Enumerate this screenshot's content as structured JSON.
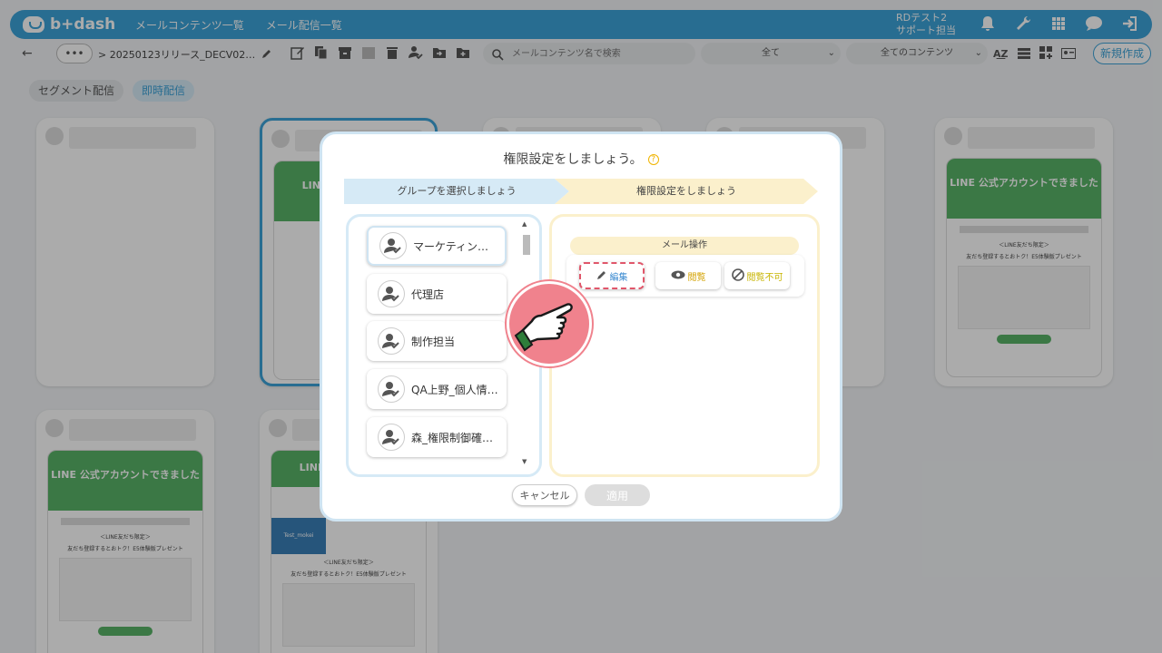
{
  "app": {
    "logo_text": "b+dash",
    "nav": [
      "メールコンテンツ一覧",
      "メール配信一覧"
    ],
    "user_line1": "RDテスト2",
    "user_line2": "サポート担当"
  },
  "toolbar": {
    "dots": "•••",
    "breadcrumb": "> 20250123リリース_DECV02…",
    "search_placeholder": "メールコンテンツ名で検索",
    "filter1": "全て",
    "filter2": "全てのコンテンツ",
    "new_button": "新規作成"
  },
  "segments": {
    "tab1": "セグメント配信",
    "tab2": "即時配信"
  },
  "cards_lp": {
    "banner": "LINE 公式アカウント",
    "banner_suffix": "できました",
    "promo_title": "＜LINE友だち限定＞",
    "promo_sub": "友だち登録するとおトク！E5体験版プレゼント",
    "test_label": "Test_mokei"
  },
  "modal": {
    "title": "権限設定をしましょう。",
    "help": "?",
    "step1": "グループを選択しましょう",
    "step2": "権限設定をしましょう",
    "groups": [
      "マーケティン…",
      "代理店",
      "制作担当",
      "QA上野_個人情…",
      "森_権限制御確…"
    ],
    "mail_operation": "メール操作",
    "op_edit": "編集",
    "op_view": "閲覧",
    "op_none": "閲覧不可",
    "cancel": "キャンセル",
    "apply": "適用"
  },
  "colors": {
    "accent": "#3da3d8",
    "step2_bg": "#fbf0cc",
    "danger": "#e0566a",
    "lp_green": "#58b368"
  }
}
